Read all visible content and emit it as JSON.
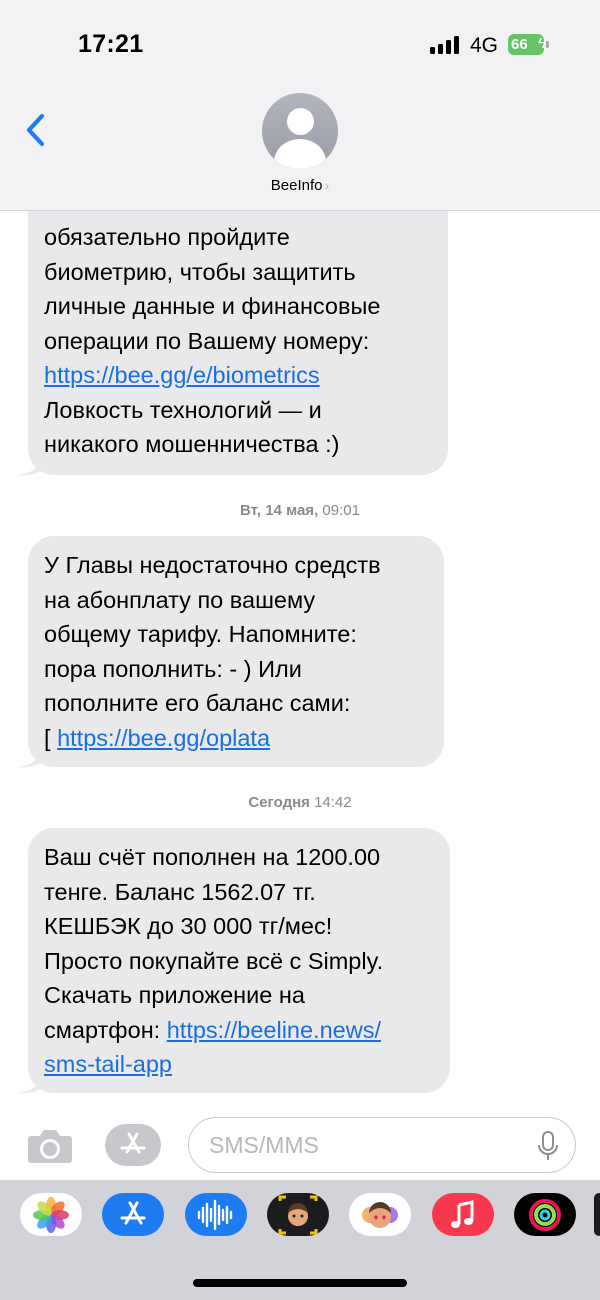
{
  "status_bar": {
    "time": "17:21",
    "network": "4G",
    "battery": "66",
    "signal_bars": 4,
    "battery_color": "#65c466"
  },
  "header": {
    "back_icon": "chevron-left-icon",
    "avatar_icon": "person-silhouette-icon",
    "contact_name": "BeeInfo",
    "contact_chevron": "›"
  },
  "messages": [
    {
      "lines": [
        {
          "text": "обязательно пройдите"
        },
        {
          "text": "биометрию, чтобы защитить"
        },
        {
          "text": "личные данные и финансовые"
        },
        {
          "text": "операции по Вашему номеру:"
        },
        {
          "link": "https://bee.gg/e/biometrics"
        },
        {
          "text": "Ловкость технологий — и"
        },
        {
          "text": "никакого мошенничества :)"
        }
      ]
    },
    {
      "timestamp_day": "Вт, 14 мая,",
      "timestamp_time": "09:01",
      "lines": [
        {
          "text": "У Главы недостаточно средств"
        },
        {
          "text": "на абонплату по вашему"
        },
        {
          "text": "общему тарифу. Напомните:"
        },
        {
          "text": "пора пополнить: - ) Или"
        },
        {
          "text": "пополните его баланс сами:"
        },
        {
          "text": "[ ",
          "link": "https://bee.gg/oplata"
        }
      ]
    },
    {
      "timestamp_day": "Сегодня",
      "timestamp_time": "14:42",
      "lines": [
        {
          "text": "Ваш счёт пополнен на 1200.00"
        },
        {
          "text": "тенге. Баланс 1562.07 тг."
        },
        {
          "text": "КЕШБЭК до 30 000 тг/мес!"
        },
        {
          "text": "Просто покупайте всё с Simply."
        },
        {
          "text": "Скачать приложение на"
        },
        {
          "text": "смартфон: ",
          "link": "https://beeline.news/"
        },
        {
          "link": "sms-tail-app"
        }
      ]
    }
  ],
  "input_bar": {
    "camera_icon": "camera-icon",
    "apps_icon": "app-store-icon",
    "placeholder": "SMS/MMS",
    "mic_icon": "microphone-icon"
  },
  "app_drawer": [
    {
      "name": "photos-icon",
      "bg": "#ffffff"
    },
    {
      "name": "app-store-icon",
      "bg": "#1e7cf2"
    },
    {
      "name": "audio-message-icon",
      "bg": "#1e7cf2"
    },
    {
      "name": "memoji-icon",
      "bg": "#1c1c1e"
    },
    {
      "name": "memoji-stickers-icon",
      "bg": "#ffffff"
    },
    {
      "name": "music-icon",
      "bg": "#f8394d"
    },
    {
      "name": "activity-icon",
      "bg": "#000000"
    }
  ],
  "colors": {
    "bubble": "#e9e9eb",
    "link": "#1a6fe0",
    "accent": "#1e7cf2"
  }
}
